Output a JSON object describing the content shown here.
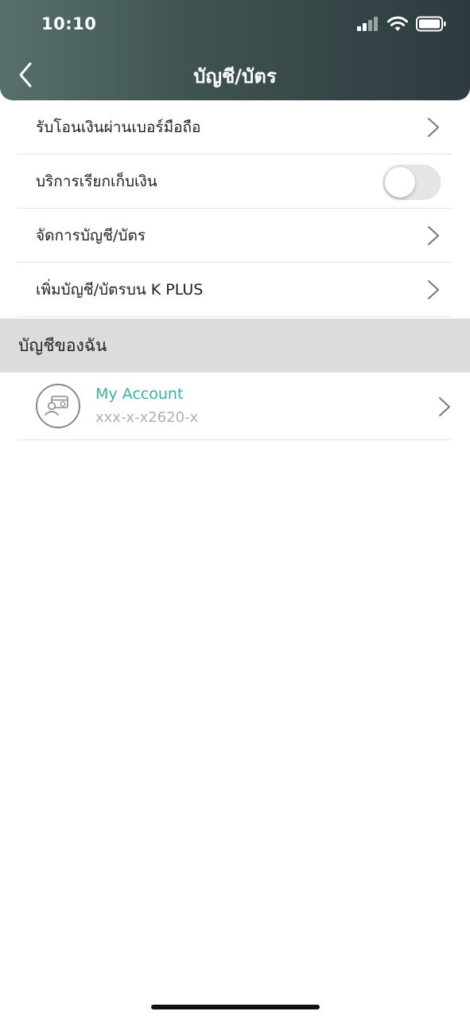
{
  "status_bar": {
    "time": "10:10"
  },
  "header": {
    "title": "บัญชี/บัตร"
  },
  "menu": {
    "items": [
      {
        "label": "รับโอนเงินผ่านเบอร์มือถือ"
      },
      {
        "label": "บริการเรียกเก็บเงิน",
        "toggle_on": false
      },
      {
        "label": "จัดการบัญชี/บัตร"
      },
      {
        "label": "เพิ่มบัญชี/บัตรบน K PLUS"
      }
    ]
  },
  "section": {
    "title": "บัญชีของฉัน"
  },
  "account": {
    "name": "My Account",
    "number": "xxx-x-x2620-x"
  },
  "colors": {
    "accent": "#33b3a1",
    "header_dark": "#2e3a3f",
    "header_light": "#58706c"
  }
}
